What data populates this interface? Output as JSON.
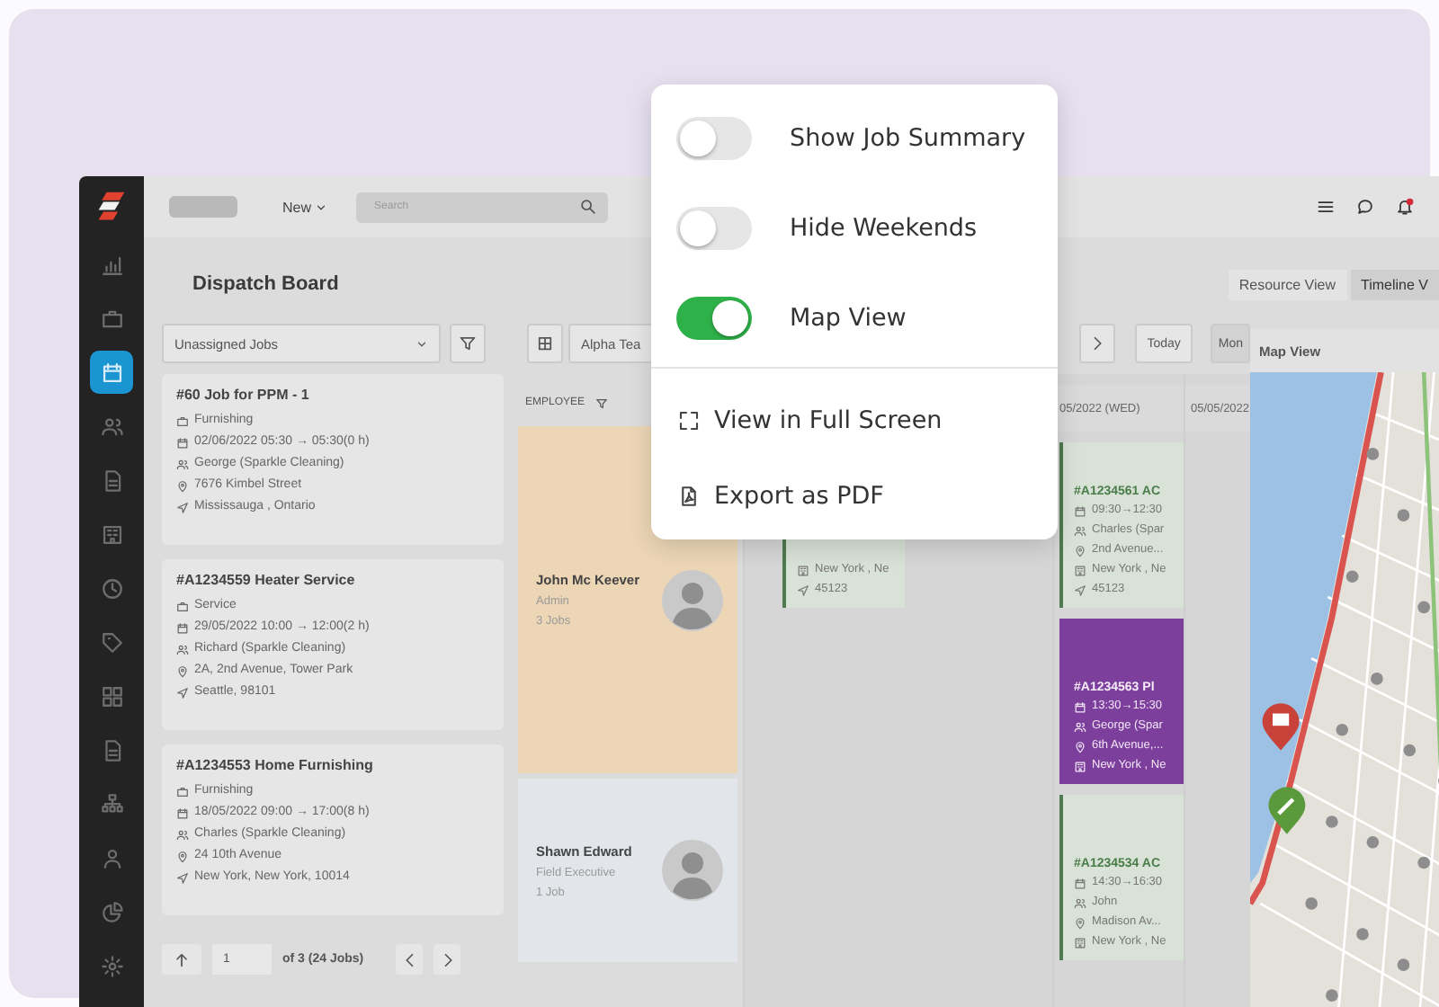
{
  "sidebar": {
    "items": [
      {
        "kind": "chart",
        "selected": false
      },
      {
        "kind": "briefcase",
        "selected": false
      },
      {
        "kind": "calendar",
        "selected": true
      },
      {
        "kind": "people",
        "selected": false
      },
      {
        "kind": "document",
        "selected": false
      },
      {
        "kind": "building",
        "selected": false
      },
      {
        "kind": "clock",
        "selected": false
      },
      {
        "kind": "tag",
        "selected": false
      },
      {
        "kind": "grid",
        "selected": false
      },
      {
        "kind": "document",
        "selected": false
      },
      {
        "kind": "org",
        "selected": false
      },
      {
        "kind": "person",
        "selected": false
      },
      {
        "kind": "pie",
        "selected": false
      },
      {
        "kind": "gear",
        "selected": false
      }
    ]
  },
  "topbar": {
    "new_menu": "New",
    "search": {
      "placeholder": "Search"
    }
  },
  "header": {
    "title": "Dispatch Board",
    "views": [
      {
        "label": "Resource View",
        "selected": false
      },
      {
        "label": "Timeline V",
        "selected": true
      }
    ]
  },
  "toolbar": {
    "job_filter": "Unassigned Jobs",
    "team": "Alpha Tea",
    "today": "Today",
    "range": "Mon"
  },
  "jobs": [
    {
      "title": "#60 Job for PPM - 1",
      "lines": [
        {
          "kind": "briefcase",
          "text": "Furnishing"
        },
        {
          "kind": "calendar",
          "text": "02/06/2022 05:30 → 05:30(0 h)"
        },
        {
          "kind": "people",
          "text": "George (Sparkle Cleaning)"
        },
        {
          "kind": "pin",
          "text": "7676 Kimbel Street"
        },
        {
          "kind": "navigate",
          "text": "Mississauga , Ontario"
        }
      ]
    },
    {
      "title": "#A1234559 Heater Service",
      "lines": [
        {
          "kind": "briefcase",
          "text": "Service"
        },
        {
          "kind": "calendar",
          "text": "29/05/2022 10:00 → 12:00(2 h)"
        },
        {
          "kind": "people",
          "text": "Richard (Sparkle Cleaning)"
        },
        {
          "kind": "pin",
          "text": "2A, 2nd Avenue, Tower Park"
        },
        {
          "kind": "navigate",
          "text": "Seattle, 98101"
        }
      ]
    },
    {
      "title": "#A1234553 Home Furnishing",
      "lines": [
        {
          "kind": "briefcase",
          "text": "Furnishing"
        },
        {
          "kind": "calendar",
          "text": "18/05/2022 09:00 → 17:00(8 h)"
        },
        {
          "kind": "people",
          "text": "Charles (Sparkle Cleaning)"
        },
        {
          "kind": "pin",
          "text": "24 10th Avenue"
        },
        {
          "kind": "navigate",
          "text": "New York, New York, 10014"
        }
      ]
    }
  ],
  "pagination": {
    "page": "1",
    "summary": "of 3 (24 Jobs)"
  },
  "employees": {
    "heading": "EMPLOYEE",
    "rows": [
      {
        "name": "John Mc Keever",
        "role": "Admin",
        "jobs": "3 Jobs",
        "color": "#ecd6b6"
      },
      {
        "name": "Shawn Edward",
        "role": "Field Executive",
        "jobs": "1 Job",
        "color": "#e2e5e9"
      }
    ]
  },
  "timeline": {
    "lanes": [
      {
        "bookings": [
          {
            "color": "#d9e2d6",
            "lines": [
              {
                "kind": "building",
                "text": "New York , Ne"
              },
              {
                "kind": "navigate",
                "text": "45123"
              }
            ]
          }
        ]
      },
      {
        "heading": "05/2022 (WED)",
        "bookings": [
          {
            "color": "#d9e2d6",
            "title": "#A1234561 AC",
            "lines": [
              {
                "kind": "calendar",
                "text": "09:30→12:30"
              },
              {
                "kind": "people",
                "text": "Charles (Spar"
              },
              {
                "kind": "pin",
                "text": "2nd Avenue..."
              },
              {
                "kind": "building",
                "text": "New York , Ne"
              },
              {
                "kind": "navigate",
                "text": "45123"
              }
            ]
          },
          {
            "color": "#7d3f9c",
            "title": "#A1234563 Pl",
            "lines": [
              {
                "kind": "calendar",
                "text": "13:30→15:30"
              },
              {
                "kind": "people",
                "text": "George (Spar"
              },
              {
                "kind": "pin",
                "text": "6th Avenue,..."
              },
              {
                "kind": "building",
                "text": "New York , Ne"
              }
            ]
          },
          {
            "color": "#d9e2d6",
            "title": "#A1234534 AC",
            "lines": [
              {
                "kind": "calendar",
                "text": "14:30→16:30"
              },
              {
                "kind": "people",
                "text": "John"
              },
              {
                "kind": "pin",
                "text": "Madison Av..."
              },
              {
                "kind": "building",
                "text": "New York , Ne"
              }
            ]
          }
        ]
      },
      {
        "heading": "05/05/2022"
      }
    ]
  },
  "map": {
    "title": "Map View"
  },
  "menu": {
    "toggles": [
      {
        "label": "Show Job Summary",
        "on": false
      },
      {
        "label": "Hide Weekends",
        "on": false
      },
      {
        "label": "Map View",
        "on": true
      }
    ],
    "actions": [
      {
        "kind": "fullscreen",
        "label": "View in Full Screen"
      },
      {
        "kind": "pdf",
        "label": "Export as PDF"
      }
    ]
  }
}
